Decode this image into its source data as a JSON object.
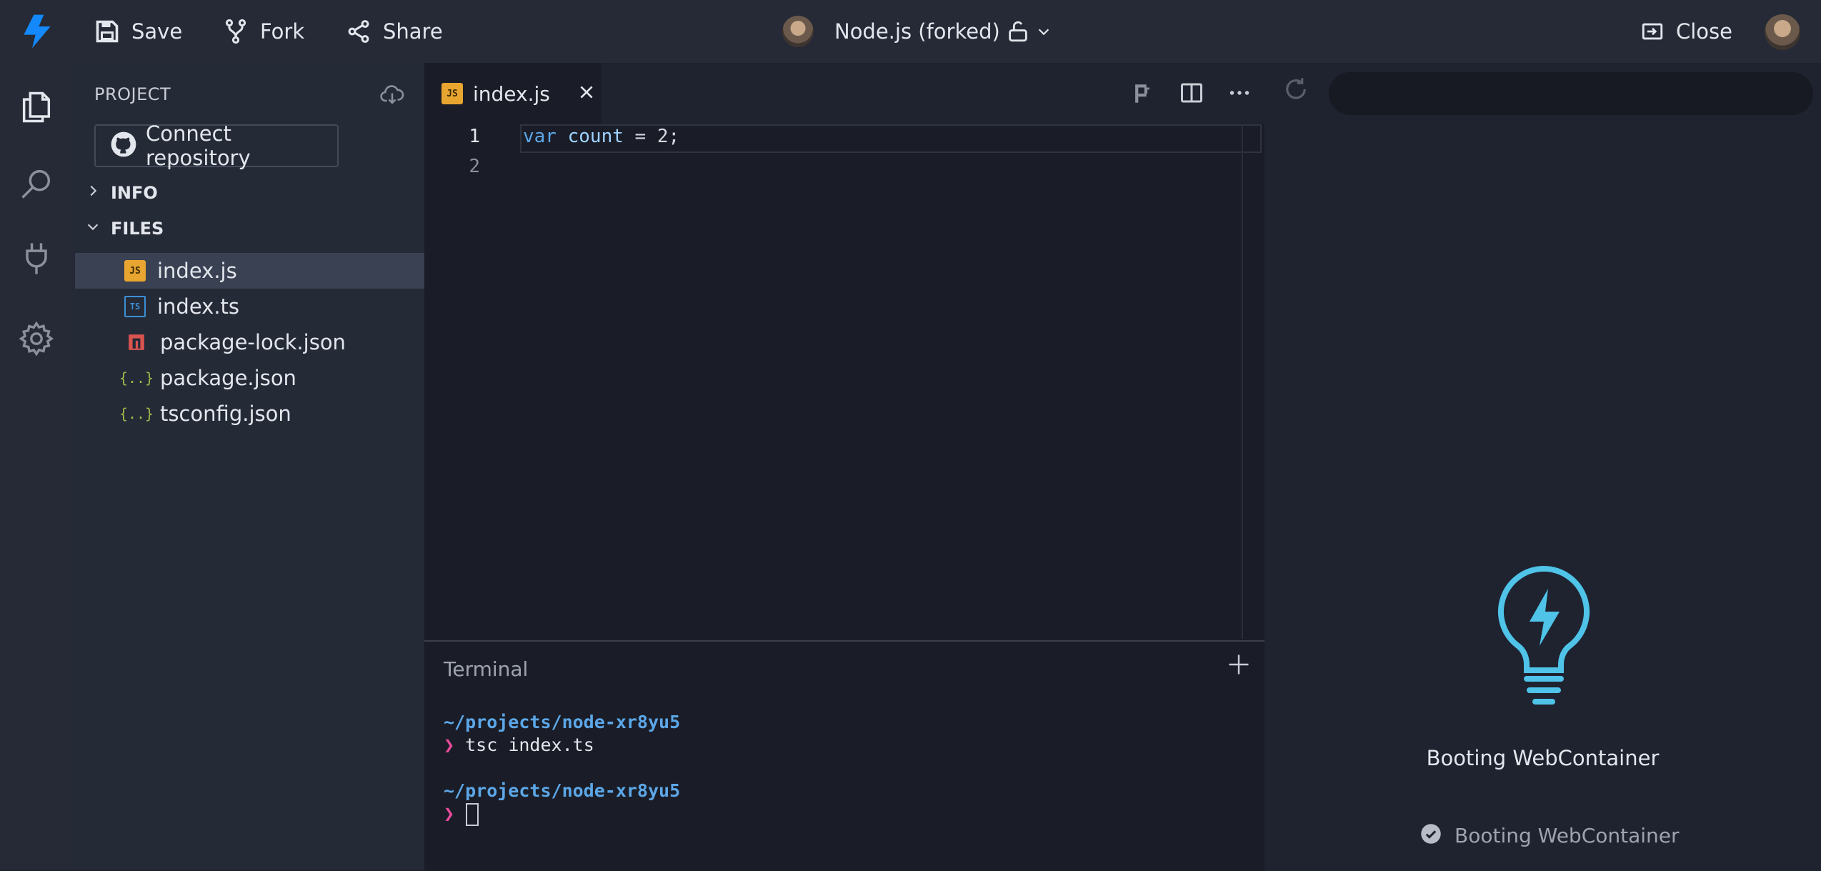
{
  "topbar": {
    "save_label": "Save",
    "fork_label": "Fork",
    "share_label": "Share",
    "project_title": "Node.js (forked)",
    "close_label": "Close",
    "colors": {
      "bolt": "#1389fd"
    }
  },
  "sidebar": {
    "project_label": "PROJECT",
    "connect_repo_label": "Connect repository",
    "sections": {
      "info": "INFO",
      "files": "FILES"
    },
    "files": [
      {
        "name": "index.js",
        "icon": "js-file-icon",
        "badge": "JS",
        "color": "#e8a530",
        "active": true
      },
      {
        "name": "index.ts",
        "icon": "ts-file-icon",
        "badge": "TS",
        "color": "#3b8fd4",
        "active": false
      },
      {
        "name": "package-lock.json",
        "icon": "npm-file-icon",
        "badge": "",
        "color": "#d9534f",
        "active": false
      },
      {
        "name": "package.json",
        "icon": "json-file-icon",
        "badge": "{..}",
        "color": "#a3b84a",
        "active": false
      },
      {
        "name": "tsconfig.json",
        "icon": "json-file-icon",
        "badge": "{..}",
        "color": "#a3b84a",
        "active": false
      }
    ]
  },
  "editor": {
    "tab_label": "index.js",
    "tab_badge": "JS",
    "line_numbers": [
      "1",
      "2"
    ],
    "code": {
      "keyword": "var",
      "identifier": "count",
      "rest": " = 2;"
    }
  },
  "terminal": {
    "title": "Terminal",
    "path1": "~/projects/node-xr8yu5",
    "prompt": "❯",
    "command": "tsc index.ts",
    "path2": "~/projects/node-xr8yu5"
  },
  "preview": {
    "booting_title": "Booting WebContainer",
    "status_text": "Booting WebContainer"
  }
}
